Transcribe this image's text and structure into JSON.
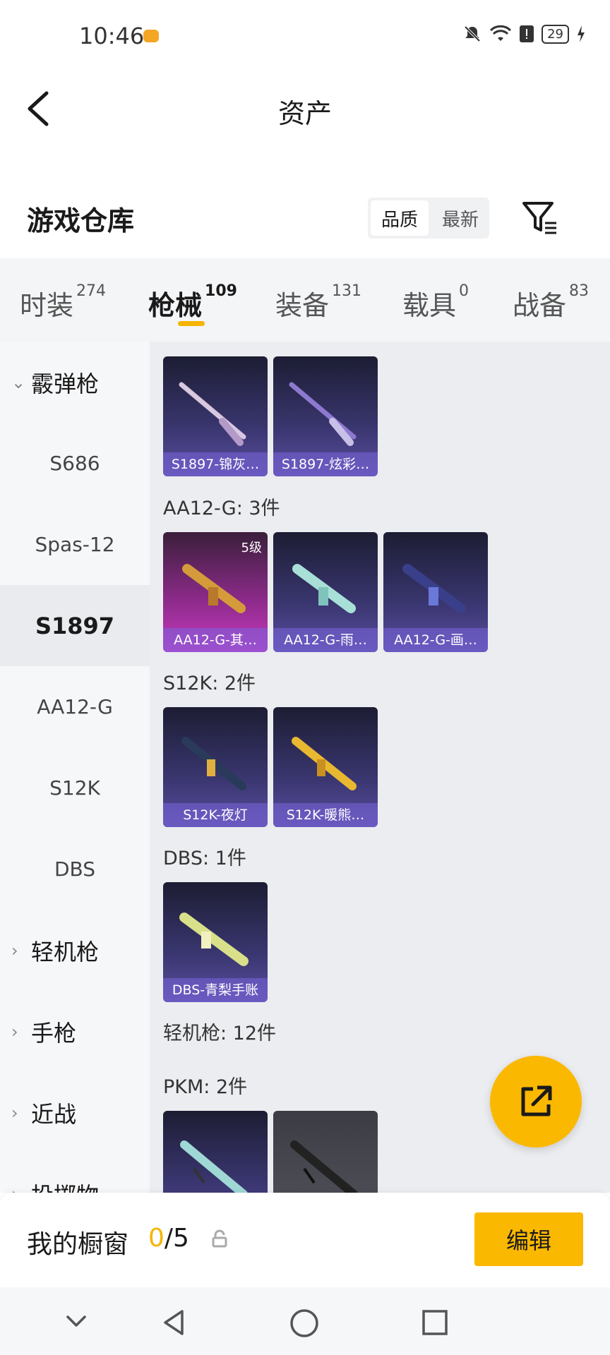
{
  "status_bar": {
    "time": "10:46",
    "battery": "29"
  },
  "header": {
    "title": "资产"
  },
  "section": {
    "title": "游戏仓库",
    "sort_options": [
      "品质",
      "最新"
    ],
    "sort_selected": "品质"
  },
  "tabs": [
    {
      "label": "时装",
      "count": "274"
    },
    {
      "label": "枪械",
      "count": "109",
      "active": true
    },
    {
      "label": "装备",
      "count": "131"
    },
    {
      "label": "载具",
      "count": "0"
    },
    {
      "label": "战备",
      "count": "83"
    }
  ],
  "nav": {
    "shotgun": "霰弹枪",
    "s686": "S686",
    "spas": "Spas-12",
    "s1897": "S1897",
    "aa12": "AA12-G",
    "s12k": "S12K",
    "dbs": "DBS",
    "lmg": "轻机枪",
    "pistol": "手枪",
    "melee": "近战",
    "throw": "投掷物"
  },
  "content": {
    "g1": {
      "items": [
        "S1897-锦灰…",
        "S1897-炫彩…"
      ]
    },
    "g2": {
      "label": "AA12-G: 3件",
      "items": [
        "AA12-G-其…",
        "AA12-G-雨…",
        "AA12-G-画…"
      ],
      "level": "5级"
    },
    "g3": {
      "label": "S12K: 2件",
      "items": [
        "S12K-夜灯",
        "S12K-暖熊…"
      ]
    },
    "g4": {
      "label": "DBS: 1件",
      "items": [
        "DBS-青梨手账"
      ]
    },
    "g5": {
      "label": "轻机枪: 12件"
    },
    "g6": {
      "label": "PKM: 2件"
    }
  },
  "bottom": {
    "label": "我的橱窗",
    "current": "0",
    "total": "/5",
    "edit": "编辑"
  },
  "colors": {
    "accent": "#fbb800",
    "card": "#3a3670",
    "card_highlight": "#c83ac0"
  },
  "icons": [
    "back-arrow-icon",
    "filter-icon",
    "edit-share-icon",
    "lock-icon",
    "chevron-down-icon",
    "chevron-right-icon"
  ]
}
